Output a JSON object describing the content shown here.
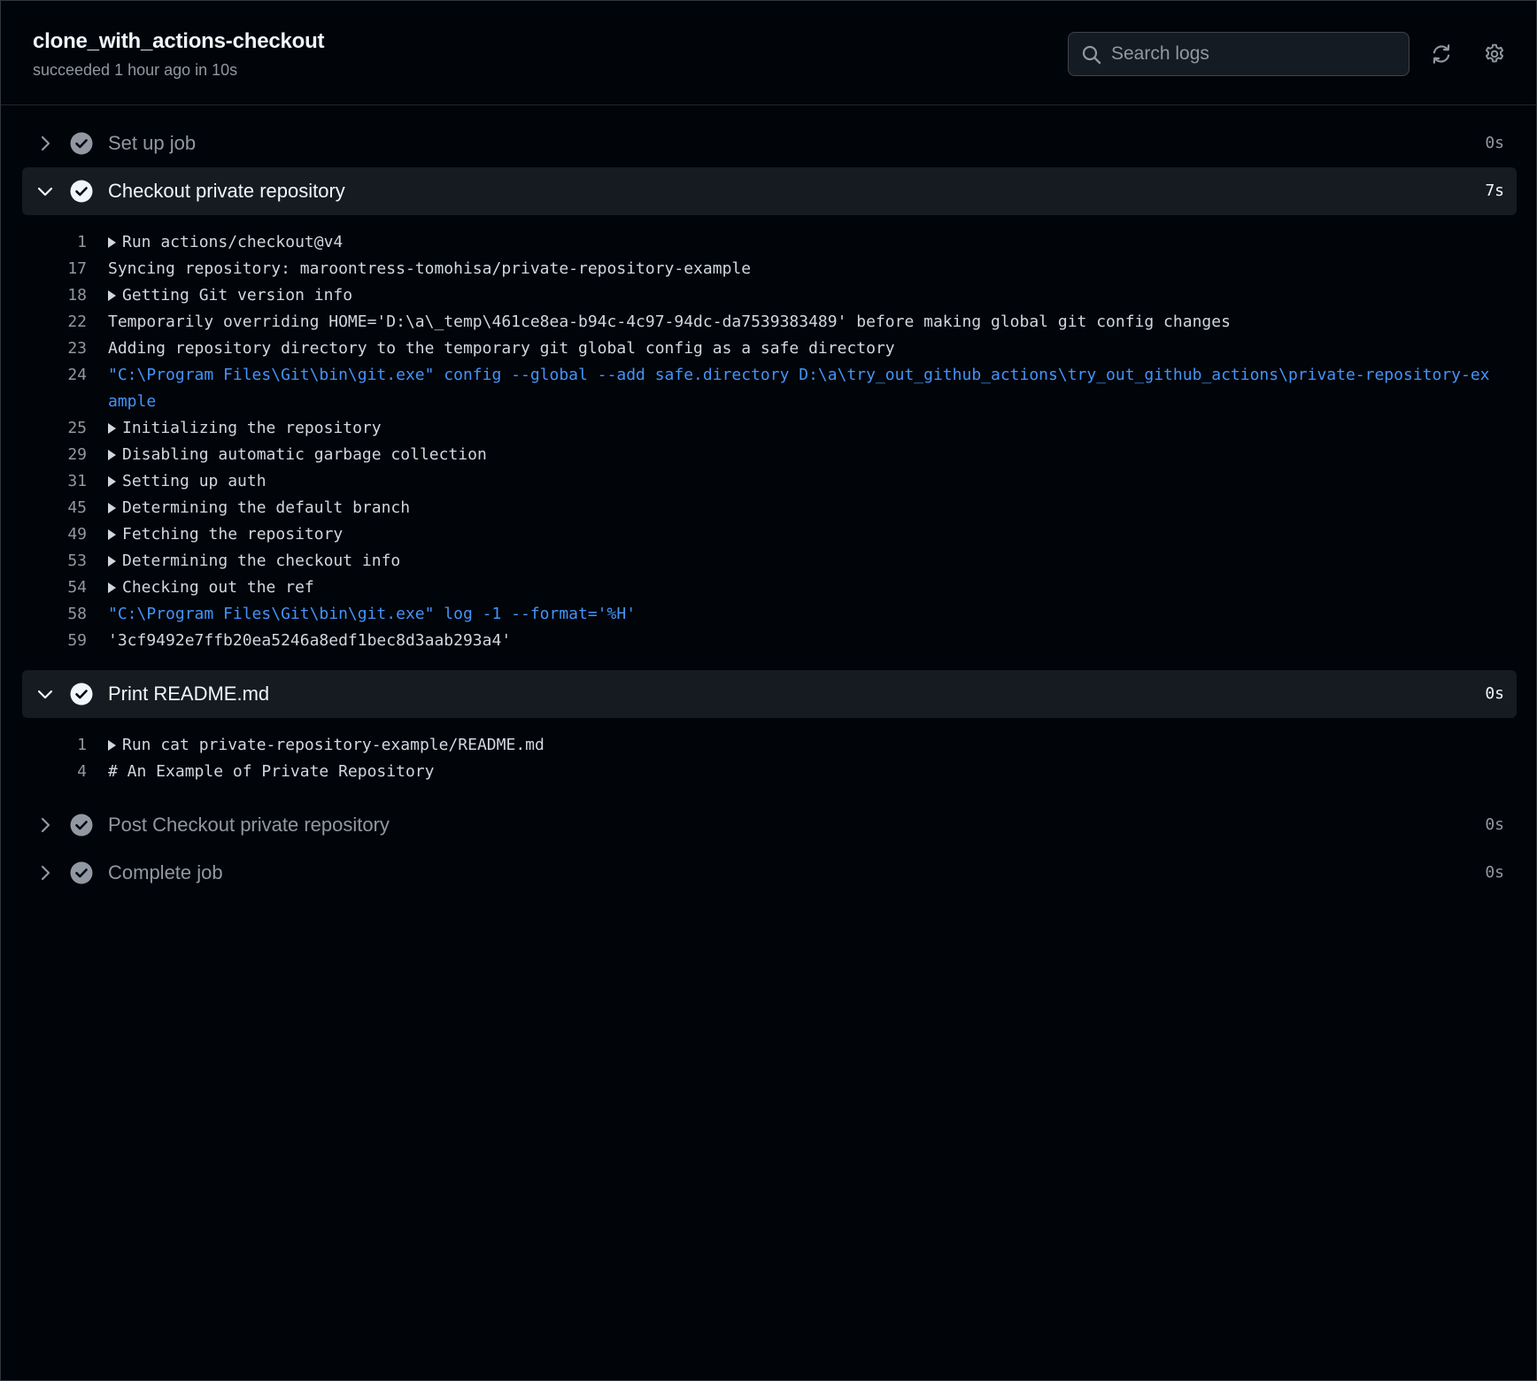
{
  "header": {
    "job_title": "clone_with_actions-checkout",
    "job_subtitle": "succeeded 1 hour ago in 10s",
    "search_placeholder": "Search logs"
  },
  "icons": {
    "search": "search-icon",
    "refresh": "refresh-icon",
    "settings": "gear-icon",
    "expand": "chevron-right-icon",
    "collapse": "chevron-down-icon",
    "status": "check-circle-icon"
  },
  "colors": {
    "background": "#010409",
    "panel": "#161b22",
    "link_blue": "#4493f8",
    "muted": "#9198a1"
  },
  "steps": [
    {
      "name": "Set up job",
      "duration": "0s",
      "expanded": false
    },
    {
      "name": "Checkout private repository",
      "duration": "7s",
      "expanded": true,
      "lines": [
        {
          "num": "1",
          "text": "Run actions/checkout@v4",
          "group": true,
          "cmd": false
        },
        {
          "num": "17",
          "text": "Syncing repository: maroontress-tomohisa/private-repository-example",
          "group": false,
          "cmd": false
        },
        {
          "num": "18",
          "text": "Getting Git version info",
          "group": true,
          "cmd": false
        },
        {
          "num": "22",
          "text": "Temporarily overriding HOME='D:\\a\\_temp\\461ce8ea-b94c-4c97-94dc-da7539383489' before making global git config changes",
          "group": false,
          "cmd": false
        },
        {
          "num": "23",
          "text": "Adding repository directory to the temporary git global config as a safe directory",
          "group": false,
          "cmd": false
        },
        {
          "num": "24",
          "text": "\"C:\\Program Files\\Git\\bin\\git.exe\" config --global --add safe.directory D:\\a\\try_out_github_actions\\try_out_github_actions\\private-repository-example",
          "group": false,
          "cmd": true
        },
        {
          "num": "25",
          "text": "Initializing the repository",
          "group": true,
          "cmd": false
        },
        {
          "num": "29",
          "text": "Disabling automatic garbage collection",
          "group": true,
          "cmd": false
        },
        {
          "num": "31",
          "text": "Setting up auth",
          "group": true,
          "cmd": false
        },
        {
          "num": "45",
          "text": "Determining the default branch",
          "group": true,
          "cmd": false
        },
        {
          "num": "49",
          "text": "Fetching the repository",
          "group": true,
          "cmd": false
        },
        {
          "num": "53",
          "text": "Determining the checkout info",
          "group": true,
          "cmd": false
        },
        {
          "num": "54",
          "text": "Checking out the ref",
          "group": true,
          "cmd": false
        },
        {
          "num": "58",
          "text": "\"C:\\Program Files\\Git\\bin\\git.exe\" log -1 --format='%H'",
          "group": false,
          "cmd": true
        },
        {
          "num": "59",
          "text": "'3cf9492e7ffb20ea5246a8edf1bec8d3aab293a4'",
          "group": false,
          "cmd": false
        }
      ]
    },
    {
      "name": "Print README.md",
      "duration": "0s",
      "expanded": true,
      "lines": [
        {
          "num": "1",
          "text": "Run cat private-repository-example/README.md",
          "group": true,
          "cmd": false
        },
        {
          "num": "4",
          "text": "# An Example of Private Repository",
          "group": false,
          "cmd": false
        }
      ]
    },
    {
      "name": "Post Checkout private repository",
      "duration": "0s",
      "expanded": false
    },
    {
      "name": "Complete job",
      "duration": "0s",
      "expanded": false
    }
  ]
}
